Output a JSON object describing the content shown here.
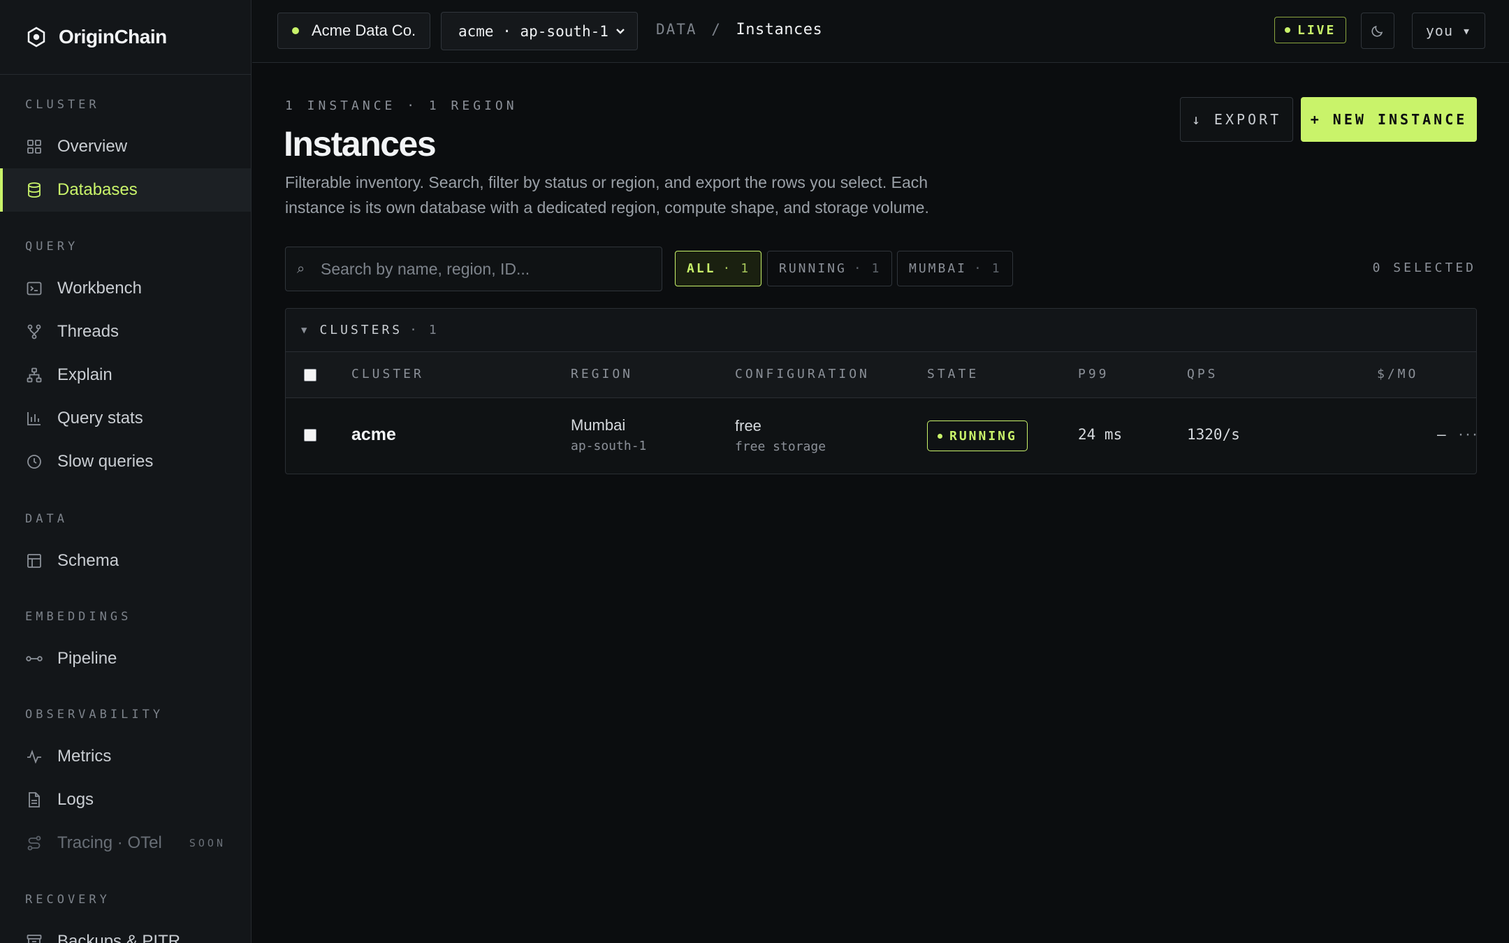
{
  "brand": {
    "name": "OriginChain"
  },
  "sidebar": {
    "sections": [
      {
        "title": "CLUSTER",
        "items": [
          {
            "label": "Overview",
            "icon": "grid-icon"
          },
          {
            "label": "Databases",
            "icon": "database-icon",
            "active": true
          }
        ]
      },
      {
        "title": "QUERY",
        "items": [
          {
            "label": "Workbench",
            "icon": "terminal-icon"
          },
          {
            "label": "Threads",
            "icon": "branch-icon"
          },
          {
            "label": "Explain",
            "icon": "tree-icon"
          },
          {
            "label": "Query stats",
            "icon": "bar-chart-icon"
          },
          {
            "label": "Slow queries",
            "icon": "clock-icon"
          }
        ]
      },
      {
        "title": "DATA",
        "items": [
          {
            "label": "Schema",
            "icon": "table-icon"
          }
        ]
      },
      {
        "title": "EMBEDDINGS",
        "items": [
          {
            "label": "Pipeline",
            "icon": "pipeline-icon"
          }
        ]
      },
      {
        "title": "OBSERVABILITY",
        "items": [
          {
            "label": "Metrics",
            "icon": "pulse-icon"
          },
          {
            "label": "Logs",
            "icon": "file-icon"
          },
          {
            "label": "Tracing · OTel",
            "icon": "route-icon",
            "disabled": true,
            "badge": "SOON"
          }
        ]
      },
      {
        "title": "RECOVERY",
        "items": [
          {
            "label": "Backups & PITR",
            "icon": "archive-icon"
          }
        ]
      }
    ]
  },
  "topbar": {
    "org": "Acme Data Co.",
    "env": "acme · ap-south-1",
    "breadcrumb_root": "DATA",
    "breadcrumb_sep": "/",
    "breadcrumb_current": "Instances",
    "live": "LIVE",
    "user": "you ▾"
  },
  "page": {
    "kicker": "1 INSTANCE · 1 REGION",
    "title": "Instances",
    "description": "Filterable inventory. Search, filter by status or region, and export the rows you select. Each instance is its own database with a dedicated region, compute shape, and storage volume.",
    "export": "↓ EXPORT",
    "new_instance": "+ NEW INSTANCE"
  },
  "filters": {
    "search_placeholder": "Search by name, region, ID...",
    "chips": [
      {
        "label": "ALL",
        "count": "· 1",
        "active": true
      },
      {
        "label": "RUNNING",
        "count": "· 1"
      },
      {
        "label": "MUMBAI",
        "count": "· 1"
      }
    ],
    "selected": "0 SELECTED"
  },
  "table": {
    "group_label": "CLUSTERS",
    "group_count": "· 1",
    "columns": {
      "cluster": "CLUSTER",
      "region": "REGION",
      "configuration": "CONFIGURATION",
      "state": "STATE",
      "p99": "P99",
      "qps": "QPS",
      "cost": "$/MO"
    },
    "rows": [
      {
        "cluster": "acme",
        "region_city": "Mumbai",
        "region_code": "ap-south-1",
        "config": "free",
        "config_sub": "free storage",
        "state": "RUNNING",
        "p99": "24 ms",
        "qps": "1320/s",
        "cost": "—",
        "more": "···"
      }
    ]
  },
  "colors": {
    "accent": "#c9f36a",
    "background": "#0b0d0f",
    "sidebar": "#131619"
  }
}
